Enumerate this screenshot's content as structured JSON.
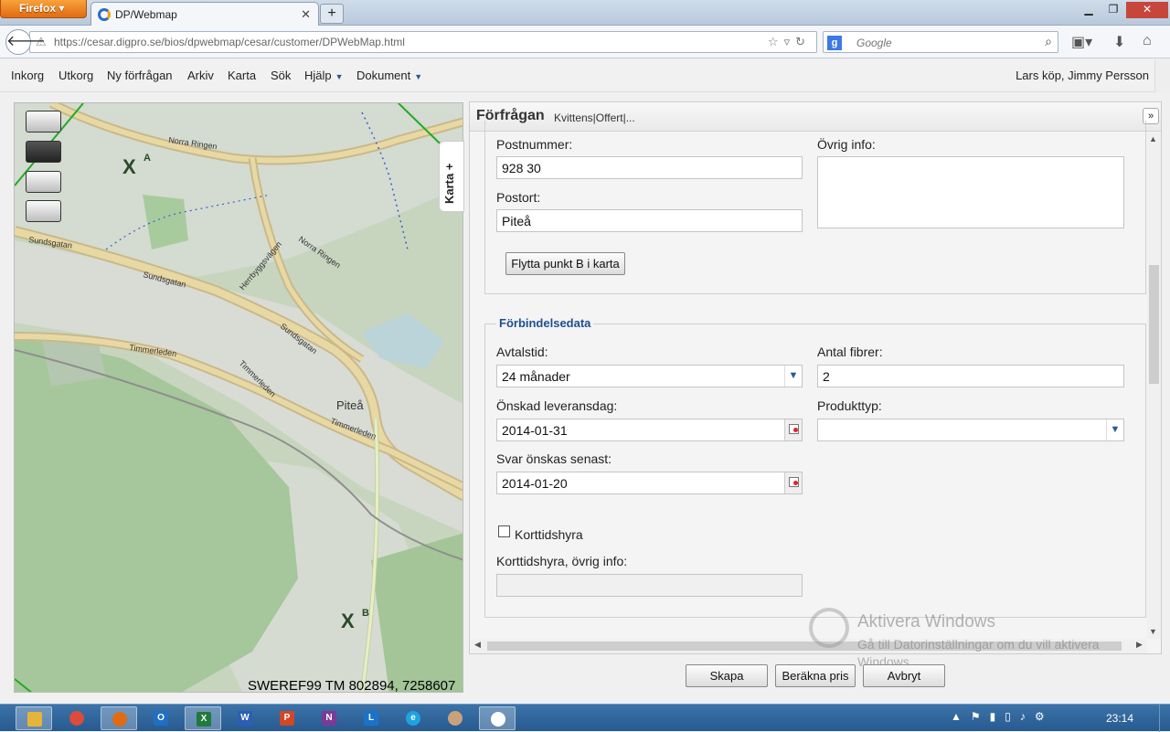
{
  "browser": {
    "menu_button": "Firefox",
    "tab_title": "DP/Webmap",
    "url": "https://cesar.digpro.se/bios/dpwebmap/cesar/customer/DPWebMap.html",
    "search_placeholder": "Google"
  },
  "appmenu": {
    "items": [
      "Inkorg",
      "Utkorg",
      "Ny förfrågan",
      "Arkiv",
      "Karta",
      "Sök",
      "Hjälp",
      "Dokument"
    ],
    "user": "Lars köp, Jimmy Persson"
  },
  "map": {
    "tab_label": "Karta +",
    "coordinates": "SWEREF99 TM 802894, 7258607",
    "point_a": "A",
    "point_b": "B",
    "labels": [
      "Norra Ringen",
      "Sundsgatan",
      "Sundsgatan",
      "Herrbyggsvägen",
      "Norra Ringen",
      "Sundsgatan",
      "Timmerleden",
      "Timmerleden",
      "Timmerleden",
      "Piteå"
    ]
  },
  "panel": {
    "title": "Förfrågan",
    "subtitle": "Kvittens|Offert|..."
  },
  "address": {
    "postnummer_label": "Postnummer:",
    "postnummer_value": "928 30",
    "postort_label": "Postort:",
    "postort_value": "Piteå",
    "ovrig_label": "Övrig info:",
    "move_button": "Flytta punkt B i karta"
  },
  "connection": {
    "legend": "Förbindelsedata",
    "avtalstid_label": "Avtalstid:",
    "avtalstid_value": "24 månader",
    "fibrer_label": "Antal fibrer:",
    "fibrer_value": "2",
    "leverans_label": "Önskad leveransdag:",
    "leverans_value": "2014-01-31",
    "produkttyp_label": "Produkttyp:",
    "svar_label": "Svar önskas senast:",
    "svar_value": "2014-01-20",
    "korttid_label": "Korttidshyra",
    "korttid_info_label": "Korttidshyra, övrig info:"
  },
  "actions": {
    "create": "Skapa",
    "calc": "Beräkna pris",
    "cancel": "Avbryt"
  },
  "watermark": {
    "title": "Aktivera Windows",
    "text": "Gå till Datorinställningar om du vill aktivera Windows."
  },
  "taskbar": {
    "time": "23:14"
  }
}
